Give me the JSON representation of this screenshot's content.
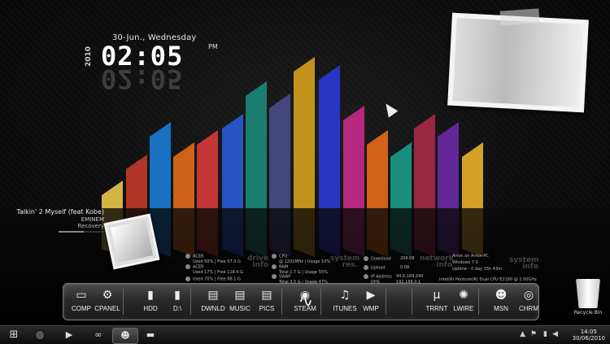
{
  "clock": {
    "date": "30-Jun., Wednesday",
    "year": "2010",
    "time": "02:05",
    "ampm": "PM"
  },
  "music": {
    "song": "Talkin' 2 Myself (feat Kobe)",
    "artist": "EMINEM",
    "album": "Recovery",
    "progress": 0.55
  },
  "stats": {
    "drive_title": "drive\ninfo",
    "drives": [
      {
        "label": "ACER",
        "detail": "Used 60% | Free 57.0 G"
      },
      {
        "label": "ACER",
        "detail": "Used 17% | Free 118.4 G"
      },
      {
        "label": "",
        "detail": "Used 70% | Free 88.1 G"
      }
    ],
    "system_res_title": "system\nres.",
    "resources": [
      {
        "label": "CPU",
        "detail": "@ 1201MHz | Usage 10%"
      },
      {
        "label": "RAM",
        "detail": "Total 1.7 G | Usage 55%"
      },
      {
        "label": "SWAP",
        "detail": "Total 3.5 G | Usage 47%"
      }
    ],
    "network_title": "network\ninfo",
    "network": [
      {
        "label": "Download",
        "value": "208.08"
      },
      {
        "label": "Upload",
        "value": "0.08"
      },
      {
        "label": "IP Address",
        "value": "94.6.189.240"
      },
      {
        "label": "DHS",
        "value": "192.168.0.1"
      }
    ],
    "system_info_title": "system\ninfo",
    "system": [
      "Arron on Arron-PC",
      "Windows 7.0",
      "Uptime - 0 day 15h 43m",
      "Intel(R) Pentium(R) Dual  CPU  E2180  @ 2.00GHz"
    ]
  },
  "dock": {
    "items": [
      {
        "label": "COMP",
        "icon": "monitor-icon",
        "glyph": "▭"
      },
      {
        "label": "CPANEL",
        "icon": "gears-icon",
        "glyph": "⚙"
      },
      {
        "label": "HDD",
        "icon": "hdd-icon",
        "glyph": "▮"
      },
      {
        "label": "D:\\",
        "icon": "drive-icon",
        "glyph": "▮"
      },
      {
        "label": "DWNLD",
        "icon": "folder-download-icon",
        "glyph": "▤"
      },
      {
        "label": "MUSIC",
        "icon": "folder-music-icon",
        "glyph": "▤"
      },
      {
        "label": "PICS",
        "icon": "folder-pictures-icon",
        "glyph": "▤"
      },
      {
        "label": "STEAM",
        "icon": "steam-icon",
        "glyph": "◉"
      },
      {
        "label": "ITUNES",
        "icon": "itunes-icon",
        "glyph": "♫"
      },
      {
        "label": "WMP",
        "icon": "wmp-icon",
        "glyph": "▶"
      },
      {
        "label": "TRRNT",
        "icon": "utorrent-icon",
        "glyph": "µ"
      },
      {
        "label": "LWIRE",
        "icon": "limewire-icon",
        "glyph": "✺"
      },
      {
        "label": "MSN",
        "icon": "msn-icon",
        "glyph": "☻"
      },
      {
        "label": "CHRM",
        "icon": "chrome-icon",
        "glyph": "◎"
      }
    ],
    "activity_icon": "activity-wave-icon"
  },
  "recycle_bin": {
    "label": "Recycle Bin"
  },
  "taskbar": {
    "start_icon": "windows-start-icon",
    "pinned": [
      {
        "icon": "chrome-icon",
        "glyph": "◎"
      },
      {
        "icon": "media-player-icon",
        "glyph": "▶"
      },
      {
        "icon": "voicemail-icon",
        "glyph": "∞"
      },
      {
        "icon": "messenger-icon",
        "glyph": "☻"
      },
      {
        "icon": "clapperboard-icon",
        "glyph": "▬"
      }
    ],
    "time": "14:05",
    "date": "30/06/2010"
  },
  "colors": {
    "crystals": [
      "#e8c64a",
      "#c13a2a",
      "#1c7bd6",
      "#e06b1a",
      "#d83a3a",
      "#2a5bd6",
      "#1c8a7a",
      "#4a4a8a",
      "#d6a01c",
      "#2a3ad6",
      "#c82a8a",
      "#e86a1a",
      "#1c9a8a",
      "#a82a4a",
      "#6a2aa8",
      "#e8b02a"
    ]
  }
}
